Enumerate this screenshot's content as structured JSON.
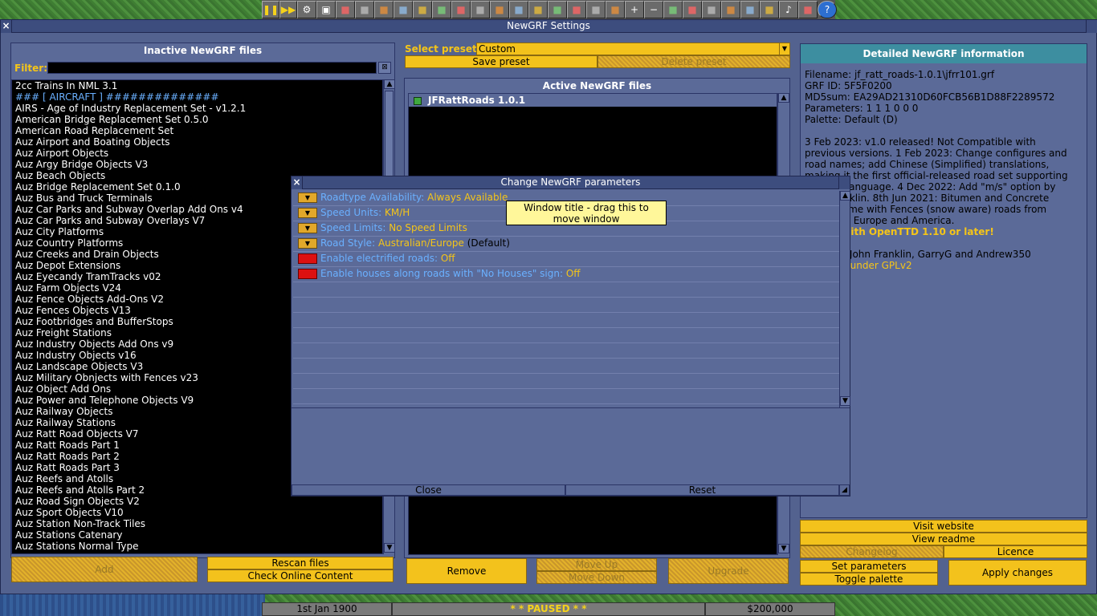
{
  "main_window": {
    "title": "NewGRF Settings",
    "close_glyph": "×"
  },
  "toolbar": {
    "icons": [
      "pause-icon",
      "fast-forward-icon",
      "settings-icon",
      "save-icon",
      "map-icon",
      "town-icon",
      "subsidies-icon",
      "stations-icon",
      "finances-icon",
      "company-icon",
      "story-icon",
      "goals-icon",
      "graphs-icon",
      "league-icon",
      "industry-icon",
      "trains-icon",
      "road-vehicles-icon",
      "ships-icon",
      "aircraft-icon",
      "zoom-in-icon",
      "zoom-out-icon",
      "build-rail-icon",
      "build-road-icon",
      "build-tram-icon",
      "build-water-icon",
      "build-air-icon",
      "landscape-icon",
      "music-icon",
      "news-icon",
      "help-icon"
    ]
  },
  "inactive_panel": {
    "caption": "Inactive NewGRF files",
    "filter_label": "Filter:",
    "filter_value": "",
    "items": [
      {
        "text": "2cc Trains In NML 3.1"
      },
      {
        "text": "### [ AIRCRAFT ] ##############",
        "highlight": true
      },
      {
        "text": "AIRS - Age of Industry Replacement Set - v1.2.1"
      },
      {
        "text": "American Bridge Replacement Set 0.5.0"
      },
      {
        "text": "American Road Replacement Set"
      },
      {
        "text": "Auz Airport and Boating Objects"
      },
      {
        "text": "Auz Airport Objects"
      },
      {
        "text": "Auz Argy Bridge Objects V3"
      },
      {
        "text": "Auz Beach Objects"
      },
      {
        "text": "Auz Bridge Replacement Set 0.1.0"
      },
      {
        "text": "Auz Bus and Truck Terminals"
      },
      {
        "text": "Auz Car Parks and Subway Overlap Add Ons v4"
      },
      {
        "text": "Auz Car Parks and Subway Overlays V7"
      },
      {
        "text": "Auz City Platforms"
      },
      {
        "text": "Auz Country Platforms"
      },
      {
        "text": "Auz Creeks and Drain Objects"
      },
      {
        "text": "Auz Depot Extensions"
      },
      {
        "text": "Auz Eyecandy TramTracks v02"
      },
      {
        "text": "Auz Farm Objects V24"
      },
      {
        "text": "Auz Fence Objects Add-Ons V2"
      },
      {
        "text": "Auz Fences Objects V13"
      },
      {
        "text": "Auz Footbridges and BufferStops"
      },
      {
        "text": "Auz Freight Stations"
      },
      {
        "text": "Auz Industry Objects Add Ons v9"
      },
      {
        "text": "Auz Industry Objects v16"
      },
      {
        "text": "Auz Landscape Objects V3"
      },
      {
        "text": "Auz Military Obnjects with Fences v23"
      },
      {
        "text": "Auz Object Add Ons"
      },
      {
        "text": "Auz Power and Telephone Objects V9"
      },
      {
        "text": "Auz Railway Objects"
      },
      {
        "text": "Auz Railway Stations"
      },
      {
        "text": "Auz Ratt Road Objects V7"
      },
      {
        "text": "Auz Ratt Roads Part 1"
      },
      {
        "text": "Auz Ratt Roads Part 2"
      },
      {
        "text": "Auz Ratt Roads Part 3"
      },
      {
        "text": "Auz Reefs and Atolls"
      },
      {
        "text": "Auz Reefs and Atolls Part 2"
      },
      {
        "text": "Auz Road Sign Objects V2"
      },
      {
        "text": "Auz Sport Objects V10"
      },
      {
        "text": "Auz Station Non-Track Tiles"
      },
      {
        "text": "Auz Stations Catenary"
      },
      {
        "text": "Auz Stations Normal Type"
      }
    ],
    "add_button": "Add",
    "rescan_button": "Rescan files",
    "check_online_button": "Check Online Content"
  },
  "preset": {
    "label": "Select preset:",
    "value": "Custom",
    "save_button": "Save preset",
    "delete_button": "Delete preset"
  },
  "active_panel": {
    "caption": "Active NewGRF files",
    "items": [
      {
        "text": "JFRattRoads 1.0.1"
      }
    ],
    "remove_button": "Remove",
    "move_up_button": "Move Up",
    "move_down_button": "Move Down",
    "upgrade_button": "Upgrade"
  },
  "details_panel": {
    "caption": "Detailed NewGRF information",
    "lines": [
      "Filename: jf_ratt_roads-1.0.1\\jfrr101.grf",
      "GRF ID: 5F5F0200",
      "MD5sum: EA29AD21310D60FCB56B1D88F2289572",
      "Parameters: 1 1 1 0 0 0",
      "Palette: Default (D)"
    ],
    "description": [
      "3 Feb 2023: v1.0 released! Not Compatible with",
      "previous versions. 1 Feb 2023: Change configures and",
      "road names; add Chinese (Simplified) translations,",
      "making it the first official-released road set supporting",
      "Chinese language. 4 Dec 2022: Add \"m/s\" option by",
      "John Franklin. 8th Jun 2021: Bitumen and Concrete",
      "Roads come with Fences (snow aware) roads from",
      "Australia, Europe and America."
    ],
    "compat_line": "Works with OpenTTD 1.10 or later!",
    "credits_line": "(C) 2023 John Franklin, GarryG and Andrew350",
    "license_line": "Licensed under GPLv2",
    "visit_website_button": "Visit website",
    "view_readme_button": "View readme",
    "changelog_button": "Changelog",
    "licence_button": "Licence",
    "set_parameters_button": "Set parameters",
    "toggle_palette_button": "Toggle palette",
    "apply_button": "Apply changes"
  },
  "param_window": {
    "title": "Change NewGRF parameters",
    "close_glyph": "×",
    "rows": [
      {
        "kind": "dropdown",
        "label": "Roadtype Availability: ",
        "value": "Always Available",
        "suffix": ""
      },
      {
        "kind": "dropdown",
        "label": "Speed Units: ",
        "value": "KM/H",
        "suffix": ""
      },
      {
        "kind": "dropdown",
        "label": "Speed Limits: ",
        "value": "No Speed Limits",
        "suffix": ""
      },
      {
        "kind": "dropdown",
        "label": "Road Style: ",
        "value": "Australian/Europe",
        "suffix": " (Default)"
      },
      {
        "kind": "bool",
        "label": "Enable electrified roads: ",
        "value": "Off",
        "suffix": ""
      },
      {
        "kind": "bool",
        "label": "Enable houses along roads with \"No Houses\" sign: ",
        "value": "Off",
        "suffix": ""
      }
    ],
    "close_button": "Close",
    "reset_button": "Reset"
  },
  "tooltip": {
    "line1": "Window title - drag this to",
    "line2": "move window"
  },
  "statusbar": {
    "date": "1st Jan 1900",
    "status": "*  *  PAUSED  *  *",
    "money": "$200,000"
  },
  "colors": {
    "window_bg": "#53628f",
    "accent_yellow": "#f3c21c",
    "link_blue": "#6ab0ff",
    "value_orange": "#f5c518"
  }
}
